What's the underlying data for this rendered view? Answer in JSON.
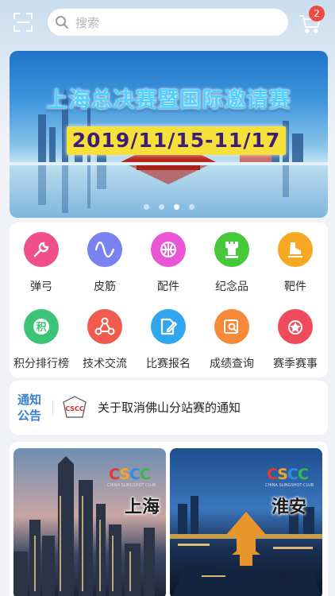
{
  "search": {
    "placeholder": "搜索"
  },
  "cart": {
    "badge": "2"
  },
  "banner": {
    "title": "上海总决赛暨国际邀请赛",
    "date": "2019/11/15-11/17",
    "dots_count": 4,
    "active_dot": 2
  },
  "menu": [
    {
      "label": "弹弓",
      "icon": "wrench-icon",
      "color": "#f0508a"
    },
    {
      "label": "皮筋",
      "icon": "wave-icon",
      "color": "#7a82f0"
    },
    {
      "label": "配件",
      "icon": "basketball-icon",
      "color": "#ea55d6"
    },
    {
      "label": "纪念品",
      "icon": "rook-icon",
      "color": "#47c73a"
    },
    {
      "label": "靶件",
      "icon": "skate-icon",
      "color": "#f6a823"
    },
    {
      "label": "积分排行榜",
      "icon": "points-icon",
      "color": "#3cc476"
    },
    {
      "label": "技术交流",
      "icon": "share-icon",
      "color": "#f15a4e"
    },
    {
      "label": "比赛报名",
      "icon": "edit-icon",
      "color": "#2fa6ee"
    },
    {
      "label": "成绩查询",
      "icon": "search-doc-icon",
      "color": "#f7893a"
    },
    {
      "label": "赛季赛事",
      "icon": "medal-icon",
      "color": "#f04b5c"
    }
  ],
  "notice": {
    "tag_line1": "通知",
    "tag_line2": "公告",
    "logo_text": "CSCC",
    "text": "关于取消佛山分站赛的通知"
  },
  "cities": [
    {
      "name": "上海",
      "logo_text": "CSCC",
      "logo_sub": "CHINA SLINGSHOT CLUB"
    },
    {
      "name": "淮安",
      "logo_text": "CSCC",
      "logo_sub": "CHINA SLINGSHOT CLUB"
    }
  ]
}
